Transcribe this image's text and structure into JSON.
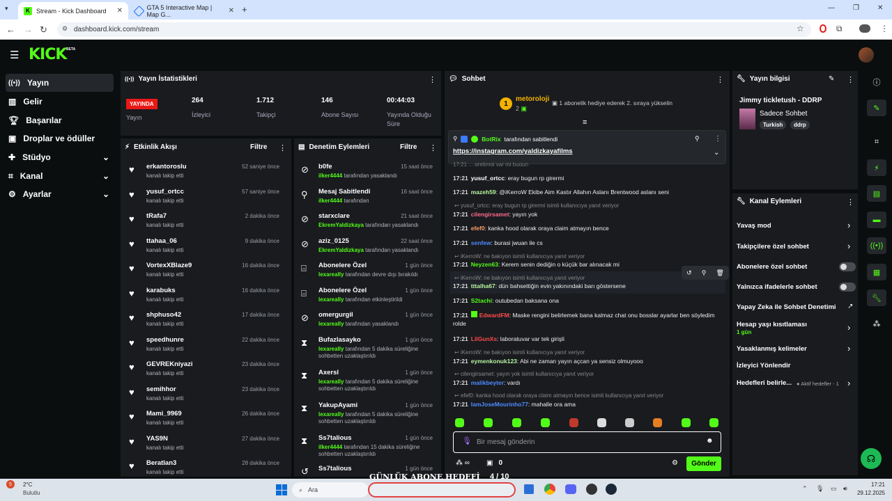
{
  "browser": {
    "tabs": [
      {
        "title": "Stream - Kick Dashboard"
      },
      {
        "title": "GTA 5 Interactive Map | Map G..."
      }
    ],
    "url": "dashboard.kick.com/stream"
  },
  "header": {
    "logo": "KICK",
    "beta": "BETA"
  },
  "sidebar": {
    "items": [
      {
        "label": "Yayın",
        "icon": "broadcast-icon"
      },
      {
        "label": "Gelir",
        "icon": "revenue-icon"
      },
      {
        "label": "Başarılar",
        "icon": "trophy-icon"
      },
      {
        "label": "Droplar ve ödüller",
        "icon": "gift-icon"
      },
      {
        "label": "Stüdyo",
        "icon": "studio-icon"
      },
      {
        "label": "Kanal",
        "icon": "channel-icon"
      },
      {
        "label": "Ayarlar",
        "icon": "gear-icon"
      }
    ]
  },
  "stats": {
    "title": "Yayın İstatistikleri",
    "live_badge": "YAYINDA",
    "live_label": "Yayın",
    "items": [
      {
        "value": "264",
        "label": "İzleyici"
      },
      {
        "value": "1.712",
        "label": "Takipçi"
      },
      {
        "value": "146",
        "label": "Abone Sayısı"
      },
      {
        "value": "00:44:03",
        "label": "Yayında Olduğu Süre"
      }
    ]
  },
  "activity": {
    "title": "Etkinlik Akışı",
    "filter": "Filtre",
    "items": [
      {
        "name": "erkantoroslu",
        "sub": "kanalı takip etti",
        "time": "52 saniye önce"
      },
      {
        "name": "yusuf_ortcc",
        "sub": "kanalı takip etti",
        "time": "57 saniye önce"
      },
      {
        "name": "tRafa7",
        "sub": "kanalı takip etti",
        "time": "2 dakika önce"
      },
      {
        "name": "ttahaa_06",
        "sub": "kanalı takip etti",
        "time": "9 dakika önce"
      },
      {
        "name": "VortexXBlaze9",
        "sub": "kanalı takip etti",
        "time": "16 dakika önce"
      },
      {
        "name": "karabuks",
        "sub": "kanalı takip etti",
        "time": "16 dakika önce"
      },
      {
        "name": "shphuso42",
        "sub": "kanalı takip etti",
        "time": "17 dakika önce"
      },
      {
        "name": "speedhunre",
        "sub": "kanalı takip etti",
        "time": "22 dakika önce"
      },
      {
        "name": "GEVREKniyazi",
        "sub": "kanalı takip etti",
        "time": "23 dakika önce"
      },
      {
        "name": "semihhor",
        "sub": "kanalı takip etti",
        "time": "23 dakika önce"
      },
      {
        "name": "Mami_9969",
        "sub": "kanalı takip etti",
        "time": "26 dakika önce"
      },
      {
        "name": "YAS9N",
        "sub": "kanalı takip etti",
        "time": "27 dakika önce"
      },
      {
        "name": "Beratlan3",
        "sub": "kanalı takip etti",
        "time": "28 dakika önce"
      }
    ]
  },
  "moderation": {
    "title": "Denetim Eylemleri",
    "filter": "Filtre",
    "items": [
      {
        "name": "b0fe",
        "actor": "ilker4444",
        "sub": "tarafından yasaklandı",
        "sub2": "",
        "time": "15 saat önce",
        "icon": "ban-icon"
      },
      {
        "name": "Mesaj Sabitlendi",
        "actor": "ilker4444",
        "sub": "tarafından",
        "sub2": "",
        "time": "16 saat önce",
        "icon": "pin-icon"
      },
      {
        "name": "starxclare",
        "actor": "EkremYaldizkaya",
        "sub": "tarafından yasaklandı",
        "sub2": "",
        "time": "21 saat önce",
        "icon": "ban-icon"
      },
      {
        "name": "aziz_0125",
        "actor": "EkremYaldizkaya",
        "sub": "tarafından yasaklandı",
        "sub2": "",
        "time": "22 saat önce",
        "icon": "ban-icon"
      },
      {
        "name": "Abonelere Özel",
        "actor": "lexareally",
        "sub": "tarafından devre dışı bırakıldı",
        "sub2": "",
        "time": "1 gün önce",
        "icon": "gift-icon"
      },
      {
        "name": "Abonelere Özel",
        "actor": "lexareally",
        "sub": "tarafından etkinleştirildi",
        "sub2": "",
        "time": "1 gün önce",
        "icon": "gift-icon"
      },
      {
        "name": "omergurgil",
        "actor": "lexareally",
        "sub": "tarafından yasaklandı",
        "sub2": "",
        "time": "1 gün önce",
        "icon": "ban-icon"
      },
      {
        "name": "Bufazlasayko",
        "actor": "lexareally",
        "sub": "tarafından 5 dakika süreliğine",
        "sub2": "sohbetten uzaklaştırıldı",
        "time": "1 gün önce",
        "icon": "timeout-icon"
      },
      {
        "name": "Axersl",
        "actor": "lexareally",
        "sub": "tarafından 5 dakika süreliğine",
        "sub2": "sohbetten uzaklaştırıldı",
        "time": "1 gün önce",
        "icon": "timeout-icon"
      },
      {
        "name": "YakupAyami",
        "actor": "lexareally",
        "sub": "tarafından 5 dakika süreliğine",
        "sub2": "sohbetten uzaklaştırıldı",
        "time": "1 gün önce",
        "icon": "timeout-icon"
      },
      {
        "name": "Ss7talious",
        "actor": "ilker4444",
        "sub": "tarafından 15 dakika süreliğine",
        "sub2": "sohbetten uzaklaştırıldı",
        "time": "1 gün önce",
        "icon": "timeout-icon"
      },
      {
        "name": "Ss7talious",
        "actor": "",
        "sub": "",
        "sub2": "",
        "time": "1 gün önce",
        "icon": "undo-icon"
      }
    ]
  },
  "chat": {
    "title": "Sohbet",
    "leader": {
      "rank": "1",
      "name": "metoroloji",
      "count": "2",
      "note": "1 abonelik hediye ederek 2. sıraya yükselin"
    },
    "pinned": {
      "by": "BotRix",
      "by_suffix": "tarafından sabitlendi",
      "link": "https://instagram.com/yaldizkayafilms"
    },
    "partial": "17:21 ... gretimgi var mi bugun",
    "lines": [
      {
        "time": "17:21",
        "user": "yusuf_ortcc",
        "color": "#ffffff",
        "text": "eray bugun rp girermi"
      },
      {
        "time": "17:21",
        "user": "mazeh59",
        "color": "#b7f5a0",
        "text": "@iKerroW Ekibe Aim Kastır Allahın Aslanı Brentwood aslanı seni"
      },
      {
        "reply": "yusuf_ortcc: eray bugun rp girermi isimli kullanıcıya yanıt veriyor"
      },
      {
        "time": "17:21",
        "user": "cilengirsamet",
        "color": "#ff6b8b",
        "text": "yayın yok"
      },
      {
        "time": "17:21",
        "user": "efef0",
        "color": "#ff9f6b",
        "text": "kanka hood olarak oraya claim atmayın bence"
      },
      {
        "time": "17:21",
        "user": "senfew",
        "color": "#4f8bff",
        "text": "burasi jwuan ile cs"
      },
      {
        "reply": "iKerroW: ne bakıyon isimli kullanıcıya yanıt veriyor"
      },
      {
        "time": "17:21",
        "user": "Neyzen63",
        "color": "#53fc18",
        "text": "Kerem senin dediğin o küçük bar alınacak mi"
      },
      {
        "reply": "iKerroW: ne bakıyon isimli kullanıcıya yanıt veriyor"
      },
      {
        "time": "17:21",
        "user": "tttalha67",
        "color": "#b7f5a0",
        "text": "dün bahsettiğin evin yakınındaki barı göstersene"
      },
      {
        "time": "17:21",
        "user": "S2tachi",
        "color": "#53fc18",
        "text": "outubedan baksana ona"
      },
      {
        "time": "17:21",
        "user": "EdwardFM",
        "color": "#ff4b4b",
        "text": "Maske rengini belirlemek bana kalmaz chat onu bosslar ayarlar ben söyledim rolde"
      },
      {
        "time": "17:21",
        "user": "LilGunXs",
        "color": "#ff4b4b",
        "text": "laboratuvar var tek girişli"
      },
      {
        "reply": "iKerroW: ne bakıyon isimli kullanıcıya yanıt veriyor"
      },
      {
        "time": "17:21",
        "user": "eymenkonuk123",
        "color": "#b7f5a0",
        "text": "Abi ne zaman yayın açcan ya sensiz olmuyooo"
      },
      {
        "reply": "cilengirsamet: yayın yok isimli kullanıcıya yanıt veriyor"
      },
      {
        "time": "17:21",
        "user": "malikbeyter",
        "color": "#4f8bff",
        "text": "vardı"
      },
      {
        "reply": "efef0: kanka hood olarak oraya claim atmayın bence isimli kullanıcıya yanıt veriyor"
      },
      {
        "time": "17:21",
        "user": "IamJoseMourinho77",
        "color": "#4f8bff",
        "text": "mahalle ora ama"
      }
    ],
    "input_placeholder": "Bir mesaj gönderin",
    "points": "0",
    "send": "Gönder"
  },
  "info": {
    "title": "Yayın bilgisi",
    "stream_title": "Jimmy tickletush - DDRP",
    "category": "Sadece Sohbet",
    "tags": [
      "Turkish",
      "ddrp"
    ]
  },
  "actions": {
    "title": "Kanal Eylemleri",
    "items": [
      {
        "label": "Yavaş mod",
        "kind": "chevron"
      },
      {
        "label": "Takipçilere özel sohbet",
        "kind": "chevron"
      },
      {
        "label": "Abonelere özel sohbet",
        "kind": "toggle"
      },
      {
        "label": "Yalnızca ifadelerle sohbet",
        "kind": "toggle"
      },
      {
        "label": "Yapay Zeka ile Sohbet Denetimi",
        "kind": "external"
      },
      {
        "label": "Hesap yaşı kısıtlaması",
        "kind": "chevron",
        "sub": "1 gün"
      },
      {
        "label": "Yasaklanmış kelimeler",
        "kind": "chevron"
      },
      {
        "label": "İzleyici Yönlendir",
        "kind": "none"
      },
      {
        "label": "Hedefleri belirle...",
        "kind": "chevron",
        "extra": "Aktif hedefler - 1"
      }
    ]
  },
  "taskbar": {
    "temp": "2°C",
    "weather": "Bulutlu",
    "search": "Ara",
    "overlay": "GÜNLÜK ABONE HEDEFİ",
    "goal": "4 / 10",
    "time": "17:21",
    "date": "29.12.2025",
    "weather_badge": "5"
  }
}
